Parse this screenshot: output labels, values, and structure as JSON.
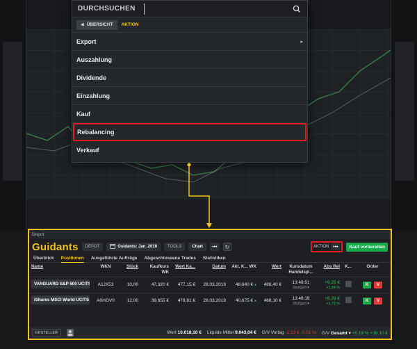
{
  "dropdown": {
    "search_label": "DURCHSUCHEN",
    "search_value": "",
    "back_label": "ÜBERSICHT",
    "active_tab": "AKTION",
    "items": [
      {
        "label": "Export",
        "has_submenu": true
      },
      {
        "label": "Auszahlung"
      },
      {
        "label": "Dividende"
      },
      {
        "label": "Einzahlung"
      },
      {
        "label": "Kauf"
      },
      {
        "label": "Rebalancing",
        "highlighted": true
      },
      {
        "label": "Verkauf"
      }
    ],
    "submenu_arrow": "▸"
  },
  "depot": {
    "title": "Depot",
    "logo_part1": "Guid",
    "logo_part2": "ants",
    "depot_label": "DEPOT",
    "depot_name": "Guidants: Jan_2019",
    "tools_label": "TOOLS",
    "chart_label": "Chart",
    "aktion_label": "AKTION",
    "more_label": "•••",
    "kauf_label": "Kauf vorbereiten",
    "tabs": [
      "Überblick",
      "Positionen",
      "Ausgeführte Aufträge",
      "Abgeschlossene Trades",
      "Statistiken"
    ],
    "columns": {
      "name": "Name",
      "wkn": "WKN",
      "stueck": "Stück",
      "kaufkurs": "Kaufkurs WK",
      "wert_ka": "Wert Ka...",
      "datum": "Datum",
      "akt_k": "Akt. K... WK",
      "wert": "Wert",
      "kursdatum": "Kursdatum Handelspl...",
      "abs_rel": "Abs Rel",
      "k": "K...",
      "order": "Order"
    },
    "rows": [
      {
        "name": "VANGUARD S&P 500 UCITS",
        "wkn": "A1JX53",
        "stueck": "10,00",
        "kaufkurs": "47,320 €",
        "wert_ka": "477,15 €",
        "datum": "28.03.2019",
        "akt_kurs": "48,640 €",
        "wert": "486,40 €",
        "kurszeit": "13:48:51",
        "handelsplatz": "Stuttgart ▾",
        "abs": "+9,25 €",
        "rel": "+1,94 %",
        "order_k": "K",
        "order_v": "V"
      },
      {
        "name": "iShares MSCI World UCITS",
        "wkn": "A0HGV0",
        "stueck": "12,00",
        "kaufkurs": "39,655 €",
        "wert_ka": "479,81 €",
        "datum": "28.03.2019",
        "akt_kurs": "40,675 €",
        "wert": "488,10 €",
        "kurszeit": "13:48:16",
        "handelsplatz": "Stuttgart ▾",
        "abs": "+8,29 €",
        "rel": "+1,73 %",
        "order_k": "K",
        "order_v": "V"
      }
    ],
    "footer": {
      "ersteller": "ERSTELLER",
      "wert_label": "Wert",
      "wert": "10.018,10 €",
      "liquide_label": "Liquide Mittel",
      "liquide": "9.043,04 €",
      "gv_vortag_label": "G/V Vortag",
      "gv_vortag_abs": "-1,13 €",
      "gv_vortag_rel": "-0,01 %",
      "gv_gesamt_label": "G/V",
      "gv_gesamt_select": "Gesamt ▾",
      "gv_gesamt_rel": "+0,18 %",
      "gv_gesamt_abs": "+18,10 €"
    }
  },
  "colors": {
    "accent_yellow": "#f2c21a",
    "highlight_red": "#e01e1e",
    "positive_green": "#21c75a",
    "negative_red": "#e23a3a"
  }
}
